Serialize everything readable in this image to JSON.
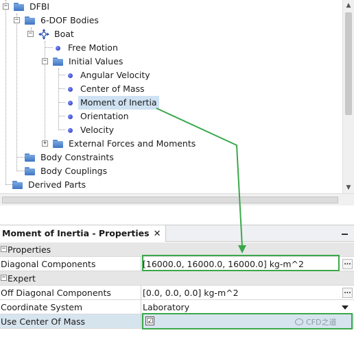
{
  "tree": {
    "items": [
      {
        "label": "DFBI"
      },
      {
        "label": "6-DOF Bodies"
      },
      {
        "label": "Boat"
      },
      {
        "label": "Free Motion"
      },
      {
        "label": "Initial Values"
      },
      {
        "label": "Angular Velocity"
      },
      {
        "label": "Center of Mass"
      },
      {
        "label": "Moment of Inertia"
      },
      {
        "label": "Orientation"
      },
      {
        "label": "Velocity"
      },
      {
        "label": "External Forces and Moments"
      },
      {
        "label": "Body Constraints"
      },
      {
        "label": "Body Couplings"
      },
      {
        "label": "Derived Parts"
      }
    ],
    "expander_minus": "−",
    "expander_plus": "+"
  },
  "properties": {
    "title": "Moment of Inertia - Properties",
    "close": "✕",
    "sections": {
      "properties": "Properties",
      "expert": "Expert"
    },
    "rows": {
      "diagonal": {
        "name": "Diagonal Components",
        "value": "[16000.0, 16000.0, 16000.0] kg-m^2"
      },
      "off_diagonal": {
        "name": "Off Diagonal Components",
        "value": "[0.0, 0.0, 0.0] kg-m^2"
      },
      "coord_system": {
        "name": "Coordinate System",
        "value": "Laboratory"
      },
      "use_com": {
        "name": "Use Center Of Mass",
        "checked": "☑"
      }
    },
    "ellipsis": "...",
    "section_toggle": "−"
  },
  "watermark": "CFD之道",
  "colors": {
    "annotation_green": "#3aa84a",
    "selection": "#cfe2f3",
    "row_highlight": "#d6e4ee"
  }
}
